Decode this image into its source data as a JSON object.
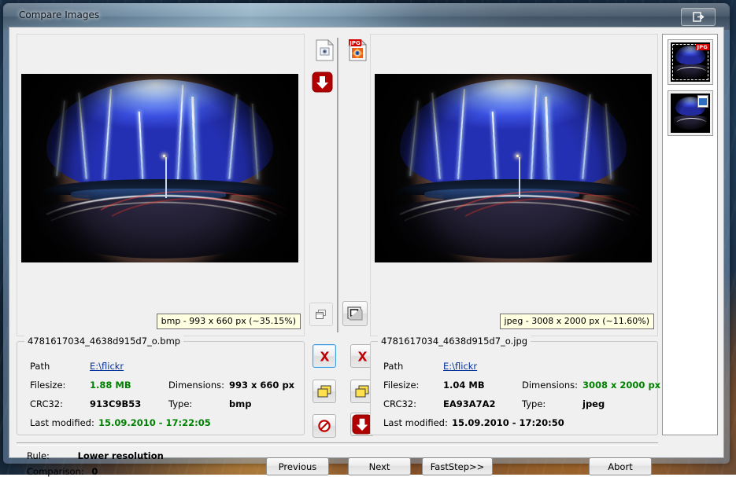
{
  "window": {
    "title": "Compare Images",
    "restore_button_label": "restore-down"
  },
  "left_pane": {
    "caption": "bmp - 993 x 660 px (~35.15%)",
    "details": {
      "filename": "4781617034_4638d915d7_o.bmp",
      "path_label": "Path",
      "path_value": "E:\\flickr",
      "filesize_label": "Filesize:",
      "filesize_value": "1.88 MB",
      "dimensions_label": "Dimensions:",
      "dimensions_value": "993 x 660 px",
      "crc_label": "CRC32:",
      "crc_value": "913C9B53",
      "type_label": "Type:",
      "type_value": "bmp",
      "modified_label": "Last modified:",
      "modified_value": "15.09.2010 - 17:22:05"
    }
  },
  "right_pane": {
    "caption": "jpeg - 3008 x 2000 px (~11.60%)",
    "details": {
      "filename": "4781617034_4638d915d7_o.jpg",
      "path_label": "Path",
      "path_value": "E:\\flickr",
      "filesize_label": "Filesize:",
      "filesize_value": "1.04 MB",
      "dimensions_label": "Dimensions:",
      "dimensions_value": "3008 x 2000 px",
      "crc_label": "CRC32:",
      "crc_value": "EA93A7A2",
      "type_label": "Type:",
      "type_value": "jpeg",
      "modified_label": "Last modified:",
      "modified_value": "15.09.2010 - 17:20:50"
    }
  },
  "center_toolbar": {
    "left_file_icon": "generic-file-icon",
    "right_file_icon": "jpg-file-icon",
    "left_move_down": "red-down-arrow-icon",
    "left_copy": "copy-window-icon",
    "right_copy": "window-square-icon",
    "left_delete": "red-x-icon",
    "right_delete": "red-x-icon",
    "left_duplicate": "yellow-pages-icon",
    "right_duplicate": "yellow-pages-icon",
    "left_block": "no-entry-icon",
    "right_move_down": "red-down-arrow-icon"
  },
  "status": {
    "rule_label": "Rule:",
    "rule_value": "Lower resolution",
    "comparison_label": "Comparison:",
    "comparison_value": "0"
  },
  "buttons": {
    "previous": "Previous",
    "next": "Next",
    "faststep": "FastStep>>",
    "abort": "Abort"
  },
  "thumbnails": [
    {
      "badge": "JPG",
      "selected": true
    },
    {
      "badge": "",
      "selected": false
    }
  ],
  "colors": {
    "accent_green": "#008000",
    "link_blue": "#00309c",
    "delete_red": "#c00000",
    "tooltip_bg": "#ffffe1"
  }
}
